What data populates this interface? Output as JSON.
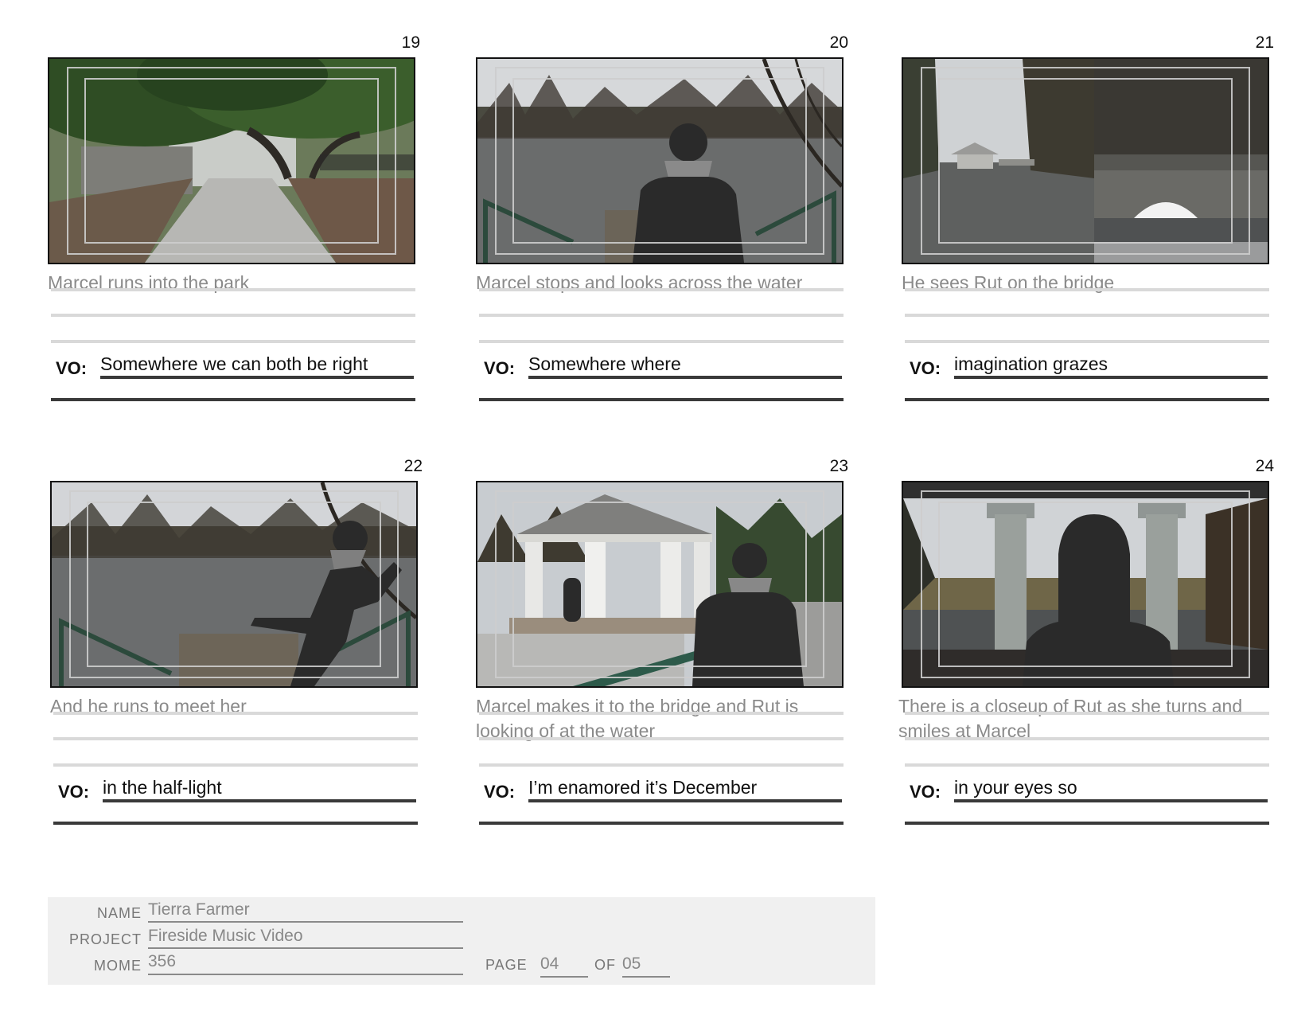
{
  "panels": [
    {
      "number": "19",
      "description": "Marcel runs into the park",
      "vo_label": "VO:",
      "vo": "Somewhere we can both be right"
    },
    {
      "number": "20",
      "description": "Marcel stops and looks across the water",
      "vo_label": "VO:",
      "vo": "Somewhere where"
    },
    {
      "number": "21",
      "description": "He sees Rut on the bridge",
      "vo_label": "VO:",
      "vo": "imagination grazes"
    },
    {
      "number": "22",
      "description": "And he runs to meet her",
      "vo_label": "VO:",
      "vo": "in the half-light"
    },
    {
      "number": "23",
      "description": "Marcel makes it to the bridge and Rut is looking of at the water",
      "vo_label": "VO:",
      "vo": "I’m enamored it’s December"
    },
    {
      "number": "24",
      "description": "There is a closeup of Rut as she turns and smiles at Marcel",
      "vo_label": "VO:",
      "vo": "in your eyes so"
    }
  ],
  "footer": {
    "name_label": "NAME",
    "name": "Tierra Farmer",
    "project_label": "PROJECT",
    "project": "Fireside Music Video",
    "mome_label": "MOME",
    "mome": "356",
    "page_label": "PAGE",
    "page": "04",
    "of_label": "OF",
    "of": "05"
  }
}
